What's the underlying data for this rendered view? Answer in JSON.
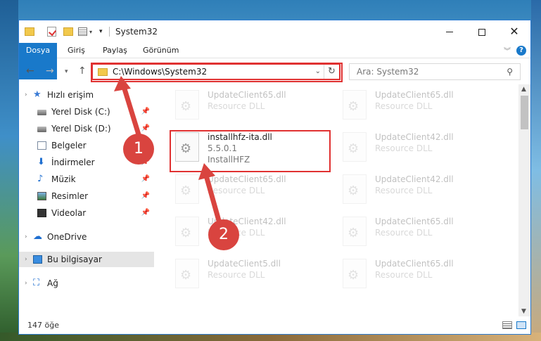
{
  "window": {
    "title": "System32",
    "controls": {
      "minimize": "minimize-icon",
      "maximize": "maximize-icon",
      "close": "✕"
    }
  },
  "ribbon": {
    "tabs": [
      "Dosya",
      "Giriş",
      "Paylaş",
      "Görünüm"
    ],
    "help": "?"
  },
  "address": {
    "path": "C:\\Windows\\System32",
    "search_placeholder": "Ara: System32"
  },
  "sidebar": {
    "quick_access": "Hızlı erişim",
    "items": [
      {
        "label": "Yerel Disk (C:)",
        "icon": "disk-icon",
        "pinned": true
      },
      {
        "label": "Yerel Disk (D:)",
        "icon": "disk-icon",
        "pinned": true
      },
      {
        "label": "Belgeler",
        "icon": "documents-icon",
        "pinned": true
      },
      {
        "label": "İndirmeler",
        "icon": "downloads-icon",
        "pinned": true
      },
      {
        "label": "Müzik",
        "icon": "music-icon",
        "pinned": true
      },
      {
        "label": "Resimler",
        "icon": "pictures-icon",
        "pinned": true
      },
      {
        "label": "Videolar",
        "icon": "videos-icon",
        "pinned": true
      }
    ],
    "onedrive": "OneDrive",
    "this_pc": "Bu bilgisayar",
    "network": "Ağ"
  },
  "files": {
    "highlighted": {
      "name": "installhfz-ita.dll",
      "version": "5.5.0.1",
      "company": "InstallHFZ"
    },
    "ghost_left": [
      {
        "name": "UpdateClient65.dll",
        "desc": "Resource DLL"
      },
      {
        "name": "UpdateClient65.dll",
        "desc": "Resource DLL"
      },
      {
        "name": "UpdateClient42.dll",
        "desc": "Resource DLL"
      },
      {
        "name": "UpdateClient5.dll",
        "desc": "Resource DLL"
      }
    ],
    "ghost_right": [
      {
        "name": "UpdateClient65.dll",
        "desc": "Resource DLL"
      },
      {
        "name": "UpdateClient42.dll",
        "desc": "Resource DLL"
      },
      {
        "name": "UpdateClient42.dll",
        "desc": "Resource DLL"
      },
      {
        "name": "UpdateClient65.dll",
        "desc": "Resource DLL"
      },
      {
        "name": "UpdateClient65.dll",
        "desc": "Resource DLL"
      }
    ]
  },
  "status": {
    "count": "147 öğe"
  },
  "annotations": {
    "step1": "1",
    "step2": "2"
  },
  "colors": {
    "accent": "#1979ca",
    "highlight": "#e03131",
    "badge": "#d9443f"
  }
}
